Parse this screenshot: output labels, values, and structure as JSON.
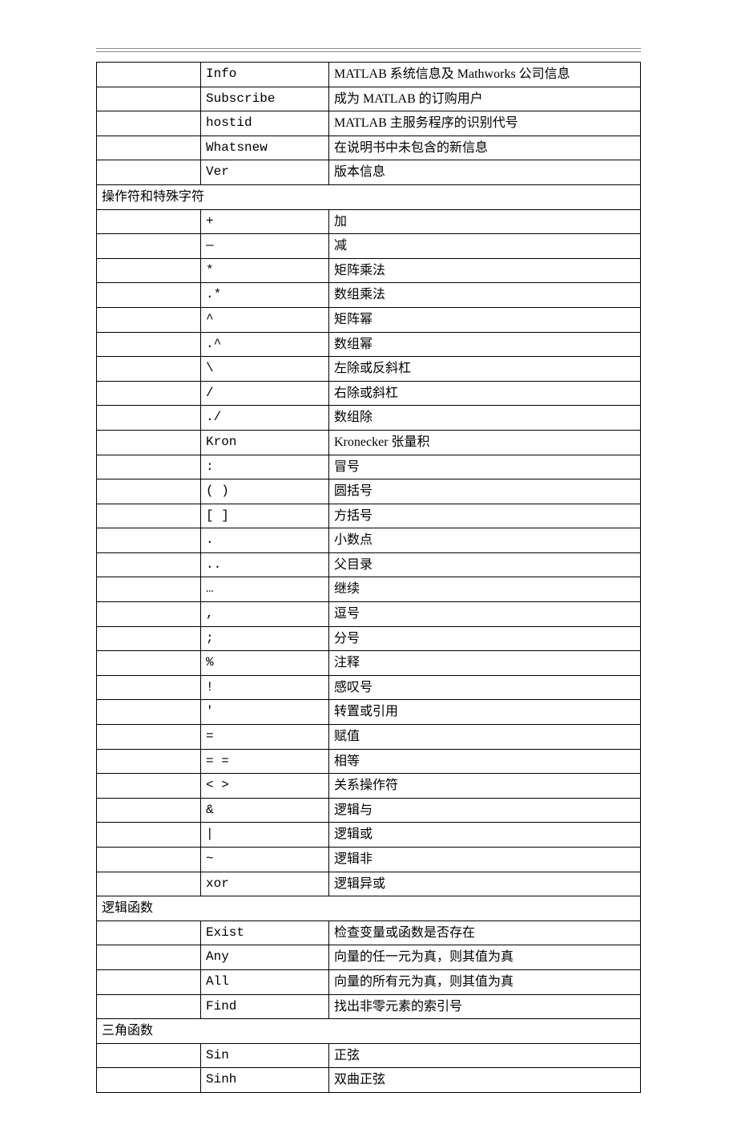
{
  "initial_rows": [
    {
      "cmd": "Info",
      "desc": "MATLAB 系统信息及 Mathworks 公司信息"
    },
    {
      "cmd": "Subscribe",
      "desc": "成为 MATLAB 的订购用户"
    },
    {
      "cmd": "hostid",
      "desc": "MATLAB 主服务程序的识别代号"
    },
    {
      "cmd": "Whatsnew",
      "desc": "在说明书中未包含的新信息"
    },
    {
      "cmd": "Ver",
      "desc": "版本信息"
    }
  ],
  "sections": [
    {
      "title": "操作符和特殊字符",
      "rows": [
        {
          "cmd": "+",
          "desc": "加"
        },
        {
          "cmd": "—",
          "desc": "减"
        },
        {
          "cmd": "*",
          "desc": "矩阵乘法"
        },
        {
          "cmd": ".*",
          "desc": "数组乘法"
        },
        {
          "cmd": "^",
          "desc": "矩阵幂"
        },
        {
          "cmd": ".^",
          "desc": "数组幂"
        },
        {
          "cmd": "\\",
          "desc": "左除或反斜杠"
        },
        {
          "cmd": "/",
          "desc": "右除或斜杠"
        },
        {
          "cmd": "./",
          "desc": "数组除"
        },
        {
          "cmd": "Kron",
          "desc": "Kronecker 张量积"
        },
        {
          "cmd": ":",
          "desc": "冒号"
        },
        {
          "cmd": "( )",
          "desc": "圆括号"
        },
        {
          "cmd": "[ ]",
          "desc": "方括号"
        },
        {
          "cmd": ".",
          "desc": "小数点"
        },
        {
          "cmd": "..",
          "desc": "父目录"
        },
        {
          "cmd": "…",
          "desc": "继续"
        },
        {
          "cmd": ",",
          "desc": "逗号"
        },
        {
          "cmd": ";",
          "desc": "分号"
        },
        {
          "cmd": "%",
          "desc": "注释"
        },
        {
          "cmd": "!",
          "desc": "感叹号"
        },
        {
          "cmd": "'",
          "desc": "转置或引用"
        },
        {
          "cmd": "=",
          "desc": "赋值"
        },
        {
          "cmd": "= =",
          "desc": "相等"
        },
        {
          "cmd": "< >",
          "desc": "关系操作符"
        },
        {
          "cmd": "&",
          "desc": "逻辑与"
        },
        {
          "cmd": "|",
          "desc": "逻辑或"
        },
        {
          "cmd": "~",
          "desc": "逻辑非"
        },
        {
          "cmd": "xor",
          "desc": "逻辑异或"
        }
      ]
    },
    {
      "title": "逻辑函数",
      "rows": [
        {
          "cmd": "Exist",
          "desc": "检查变量或函数是否存在"
        },
        {
          "cmd": "Any",
          "desc": "向量的任一元为真，则其值为真"
        },
        {
          "cmd": "All",
          "desc": "向量的所有元为真，则其值为真"
        },
        {
          "cmd": "Find",
          "desc": "找出非零元素的索引号"
        }
      ]
    },
    {
      "title": "三角函数",
      "rows": [
        {
          "cmd": "Sin",
          "desc": "正弦"
        },
        {
          "cmd": "Sinh",
          "desc": "双曲正弦"
        }
      ]
    }
  ]
}
